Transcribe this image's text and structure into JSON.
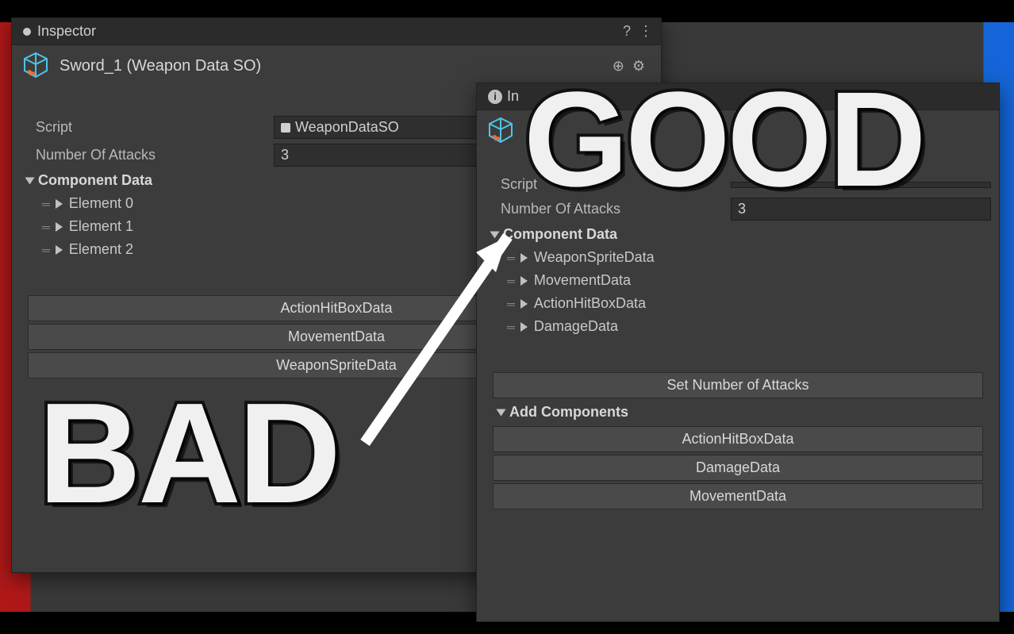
{
  "labels": {
    "good": "GOOD",
    "bad": "BAD"
  },
  "inspector_tab": "Inspector",
  "left_panel": {
    "asset_name": "Sword_1 (Weapon Data SO)",
    "script_label": "Script",
    "script_value": "WeaponDataSO",
    "num_attacks_label": "Number Of Attacks",
    "num_attacks_value": "3",
    "component_data_label": "Component Data",
    "elements": [
      "Element 0",
      "Element 1",
      "Element 2"
    ],
    "buttons": [
      "ActionHitBoxData",
      "MovementData",
      "WeaponSpriteData"
    ]
  },
  "right_panel": {
    "tab_prefix": "In",
    "script_label": "Script",
    "num_attacks_label": "Number Of Attacks",
    "num_attacks_value": "3",
    "component_data_label": "Component Data",
    "components": [
      "WeaponSpriteData",
      "MovementData",
      "ActionHitBoxData",
      "DamageData"
    ],
    "set_num_button": "Set Number of Attacks",
    "add_components_label": "Add Components",
    "add_buttons": [
      "ActionHitBoxData",
      "DamageData",
      "MovementData"
    ]
  }
}
